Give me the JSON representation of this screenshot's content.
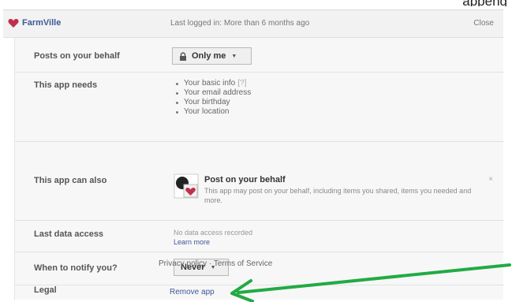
{
  "top_right_snippet": "appeng",
  "header": {
    "app_name": "FarmVille",
    "last_logged": "Last logged in: More than 6 months ago",
    "close_label": "Close",
    "heart_color": "#c0304a"
  },
  "rows": {
    "posts": {
      "label": "Posts on your behalf",
      "dropdown_value": "Only me"
    },
    "needs": {
      "label": "This app needs",
      "items": [
        {
          "text": "Your basic info",
          "tag": "[?]"
        },
        {
          "text": "Your email address",
          "tag": ""
        },
        {
          "text": "Your birthday",
          "tag": ""
        },
        {
          "text": "Your location",
          "tag": ""
        }
      ]
    },
    "also": {
      "label": "This app can also",
      "perm_title": "Post on your behalf",
      "perm_desc": "This app may post on your behalf, including items you shared, items you needed and more.",
      "remove_x": "×"
    },
    "access": {
      "label": "Last data access",
      "status": "No data access recorded",
      "learn_more": "Learn more"
    },
    "notify": {
      "label": "When to notify you?",
      "dropdown_value": "Never"
    },
    "legal": {
      "label": "Legal",
      "privacy": "Privacy policy",
      "separator": " · ",
      "terms": "Terms of Service"
    }
  },
  "remove_app": "Remove app",
  "arrow_color": "#22aa44"
}
